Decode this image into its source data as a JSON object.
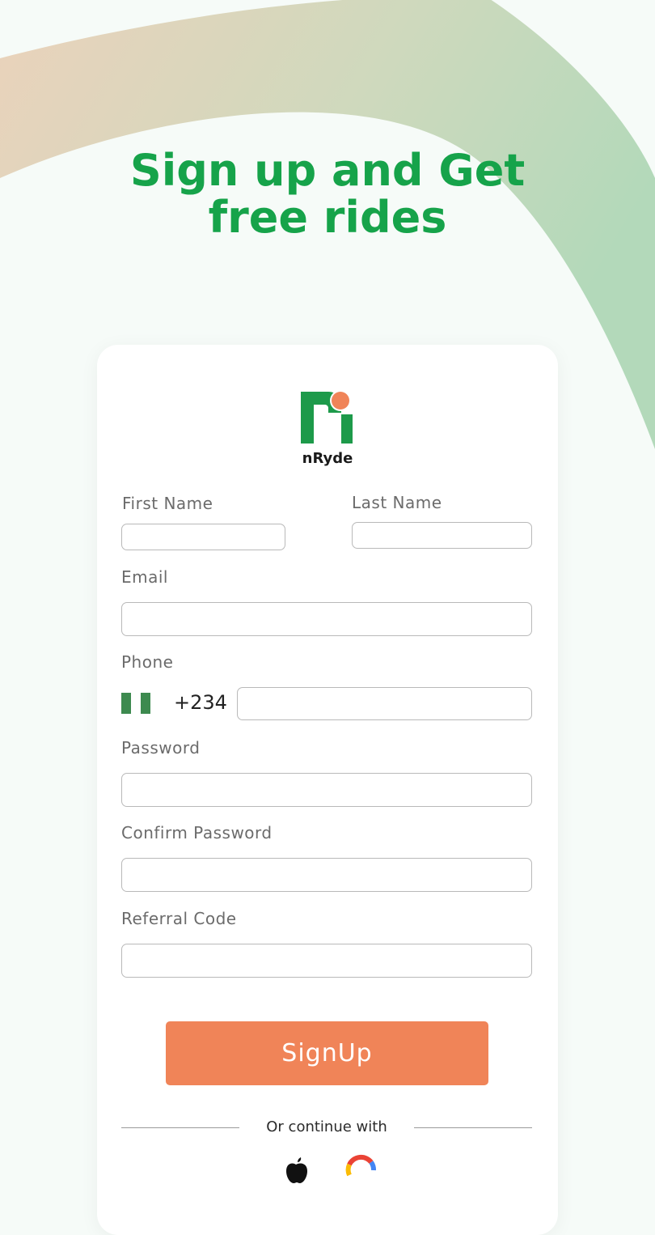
{
  "headline": {
    "line1": "Sign up and Get",
    "line2": "free rides"
  },
  "brand": {
    "name": "nRyde",
    "logo_icon": "nryde-logo-icon",
    "green": "#16a34a",
    "accent": "#f08458"
  },
  "form": {
    "first_name": {
      "label": "First Name",
      "value": ""
    },
    "last_name": {
      "label": "Last Name",
      "value": ""
    },
    "email": {
      "label": "Email",
      "value": ""
    },
    "phone": {
      "label": "Phone",
      "country_flag_icon": "nigeria-flag-icon",
      "dial_code": "+234",
      "value": ""
    },
    "password": {
      "label": "Password",
      "value": ""
    },
    "confirm_password": {
      "label": "Confirm Password",
      "value": ""
    },
    "referral_code": {
      "label": "Referral Code",
      "value": ""
    }
  },
  "signup_button": {
    "label": "SignUp"
  },
  "divider": {
    "text": "Or continue with"
  },
  "social": [
    {
      "icon": "apple-icon"
    },
    {
      "icon": "google-icon"
    }
  ]
}
